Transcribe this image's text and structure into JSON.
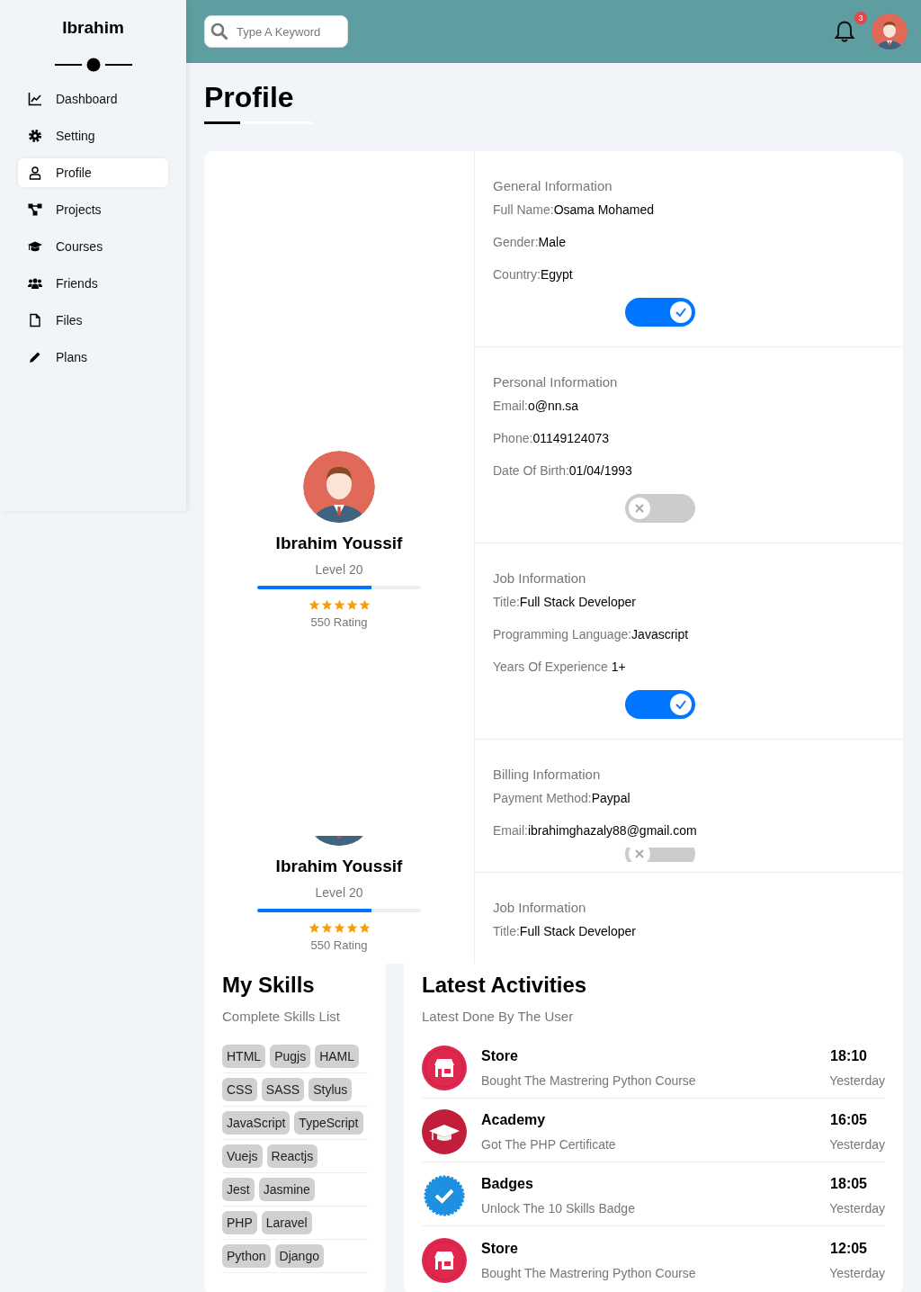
{
  "sidebar": {
    "title": "Ibrahim",
    "items": [
      {
        "label": "Dashboard",
        "selected": false
      },
      {
        "label": "Setting",
        "selected": false
      },
      {
        "label": "Profile",
        "selected": true
      },
      {
        "label": "Projects",
        "selected": false
      },
      {
        "label": "Courses",
        "selected": false
      },
      {
        "label": "Friends",
        "selected": false
      },
      {
        "label": "Files",
        "selected": false
      },
      {
        "label": "Plans",
        "selected": false
      }
    ]
  },
  "header": {
    "search": {
      "placeholder": "Type A Keyword"
    },
    "notifications": "3"
  },
  "page_title": "Profile",
  "profiles": [
    {
      "name": "Ibrahim Youssif",
      "level_text": "Level 20",
      "level": 0.7,
      "stars": 5,
      "rating": "550 Rating"
    },
    {
      "name": "Ibrahim Youssif",
      "level_text": "Level 20",
      "level": 0.7,
      "stars": 5,
      "rating": "550 Rating"
    }
  ],
  "info_sections": [
    {
      "title": "General Information",
      "fields": [
        {
          "label": "Full Name:",
          "value": "Osama Mohamed"
        },
        {
          "label": "Gender:",
          "value": "Male"
        },
        {
          "label": "Country:",
          "value": "Egypt"
        }
      ],
      "toggle": {
        "checked": true
      }
    },
    {
      "title": "Personal Information",
      "fields": [
        {
          "label": "Email:",
          "value": "o@nn.sa"
        },
        {
          "label": "Phone:",
          "value": "01149124073"
        },
        {
          "label": "Date Of Birth:",
          "value": "01/04/1993"
        }
      ],
      "toggle": {
        "checked": false
      }
    },
    {
      "title": "Job Information",
      "fields": [
        {
          "label": "Title:",
          "value": "Full Stack Developer"
        },
        {
          "label": "Programming Language:",
          "value": "Javascript"
        },
        {
          "label": "Years Of Experience ",
          "value": "1+"
        }
      ],
      "toggle": {
        "checked": true
      }
    },
    {
      "title": "Billing Information",
      "fields": [
        {
          "label": "Payment Method:",
          "value": "Paypal"
        },
        {
          "label": "Email:",
          "value": "ibrahimghazaly88@gmail.com"
        }
      ],
      "toggle": {
        "checked": false
      }
    },
    {
      "title": "Job Information",
      "fields": [
        {
          "label": "Title:",
          "value": "Full Stack Developer"
        }
      ]
    }
  ],
  "skills": {
    "title": "My Skills",
    "subtitle": "Complete Skills List",
    "rows": [
      {
        "tags": [
          "HTML",
          "Pugjs",
          "HAML"
        ]
      },
      {
        "tags": [
          "CSS",
          "SASS",
          "Stylus"
        ]
      },
      {
        "tags": [
          "JavaScript",
          "TypeScript"
        ]
      },
      {
        "tags": [
          "Vuejs",
          "Reactjs"
        ]
      },
      {
        "tags": [
          "Jest",
          "Jasmine"
        ]
      },
      {
        "tags": [
          "PHP",
          "Laravel"
        ]
      },
      {
        "tags": [
          "Python",
          "Django"
        ]
      }
    ]
  },
  "activities": {
    "title": "Latest Activities",
    "subtitle": "Latest Done By The User",
    "items": [
      {
        "kind": "store",
        "title": "Store",
        "description": "Bought The Mastrering Python Course",
        "time": "18:10",
        "day": "Yesterday"
      },
      {
        "kind": "academy",
        "title": "Academy",
        "description": "Got The PHP Certificate",
        "time": "16:05",
        "day": "Yesterday"
      },
      {
        "kind": "badge",
        "title": "Badges",
        "description": "Unlock The 10 Skills Badge",
        "time": "18:05",
        "day": "Yesterday"
      },
      {
        "kind": "store",
        "title": "Store",
        "description": "Bought The Mastrering Python Course",
        "time": "12:05",
        "day": "Yesterday"
      }
    ]
  }
}
